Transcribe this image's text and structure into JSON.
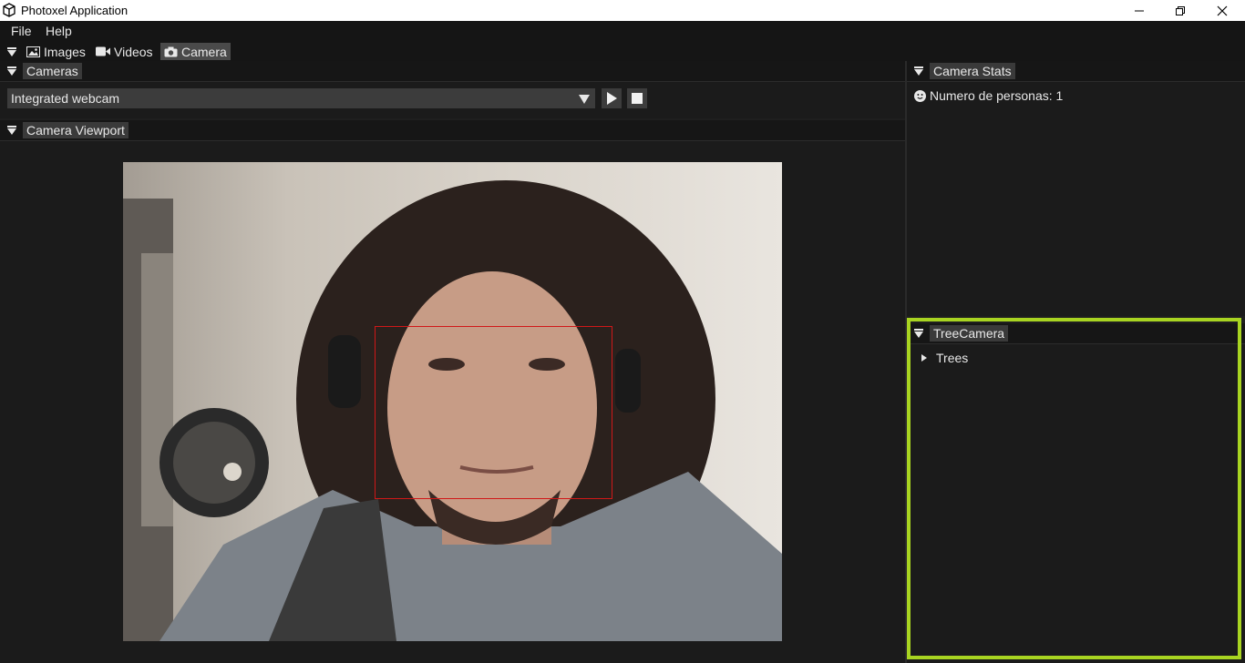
{
  "window": {
    "title": "Photoxel Application",
    "controls": [
      "minimize-icon",
      "restore-icon",
      "close-icon"
    ]
  },
  "menu": {
    "items": [
      "File",
      "Help"
    ]
  },
  "tabs": [
    {
      "label": "Images",
      "icon": "image-icon",
      "active": false
    },
    {
      "label": "Videos",
      "icon": "video-camera-icon",
      "active": false
    },
    {
      "label": "Camera",
      "icon": "camera-icon",
      "active": true
    }
  ],
  "cameras_panel": {
    "title": "Cameras",
    "selected_camera": "Integrated webcam",
    "buttons": [
      "play-icon",
      "stop-icon"
    ]
  },
  "viewport_panel": {
    "title": "Camera Viewport"
  },
  "stats_panel": {
    "title": "Camera Stats",
    "people_label": "Numero de personas: 1"
  },
  "tree_panel": {
    "title": "TreeCamera",
    "items": [
      "Trees"
    ]
  },
  "colors": {
    "highlight": "#a8d421",
    "face_box": "#d01818",
    "active_tab": "#4a4a4a"
  }
}
